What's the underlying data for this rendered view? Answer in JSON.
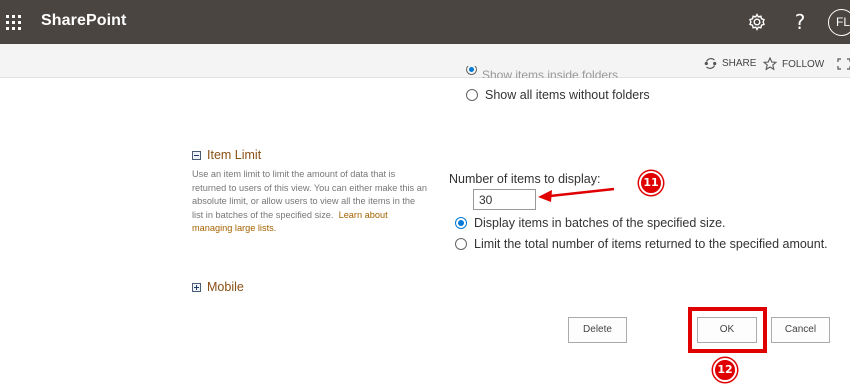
{
  "suite_bar": {
    "app_name": "SharePoint",
    "settings_icon": "gear-icon",
    "help_label": "?",
    "user_initials": "FL",
    "background": "#4a4541"
  },
  "command_bar": {
    "share_label": "SHARE",
    "follow_label": "FOLLOW"
  },
  "folders": {
    "partial_option_label": "Show items inside folders",
    "option_label": "Show all items without folders"
  },
  "item_limit": {
    "heading": "Item Limit",
    "description": "Use an item limit to limit the amount of data that is returned to users of this view. You can either make this an absolute limit, or allow users to view all the items in the list in batches of the specified size.",
    "link_label": "Learn about managing large lists.",
    "number_label": "Number of items to display:",
    "number_value": "30",
    "option_batches_label": "Display items in batches of the specified size.",
    "option_limit_label": "Limit the total number of items returned to the specified amount.",
    "selected_option": "batches"
  },
  "mobile": {
    "heading": "Mobile"
  },
  "buttons": {
    "delete_label": "Delete",
    "ok_label": "OK",
    "cancel_label": "Cancel"
  },
  "annotations": {
    "step_11": "11",
    "step_12": "12",
    "color": "#e00000"
  }
}
